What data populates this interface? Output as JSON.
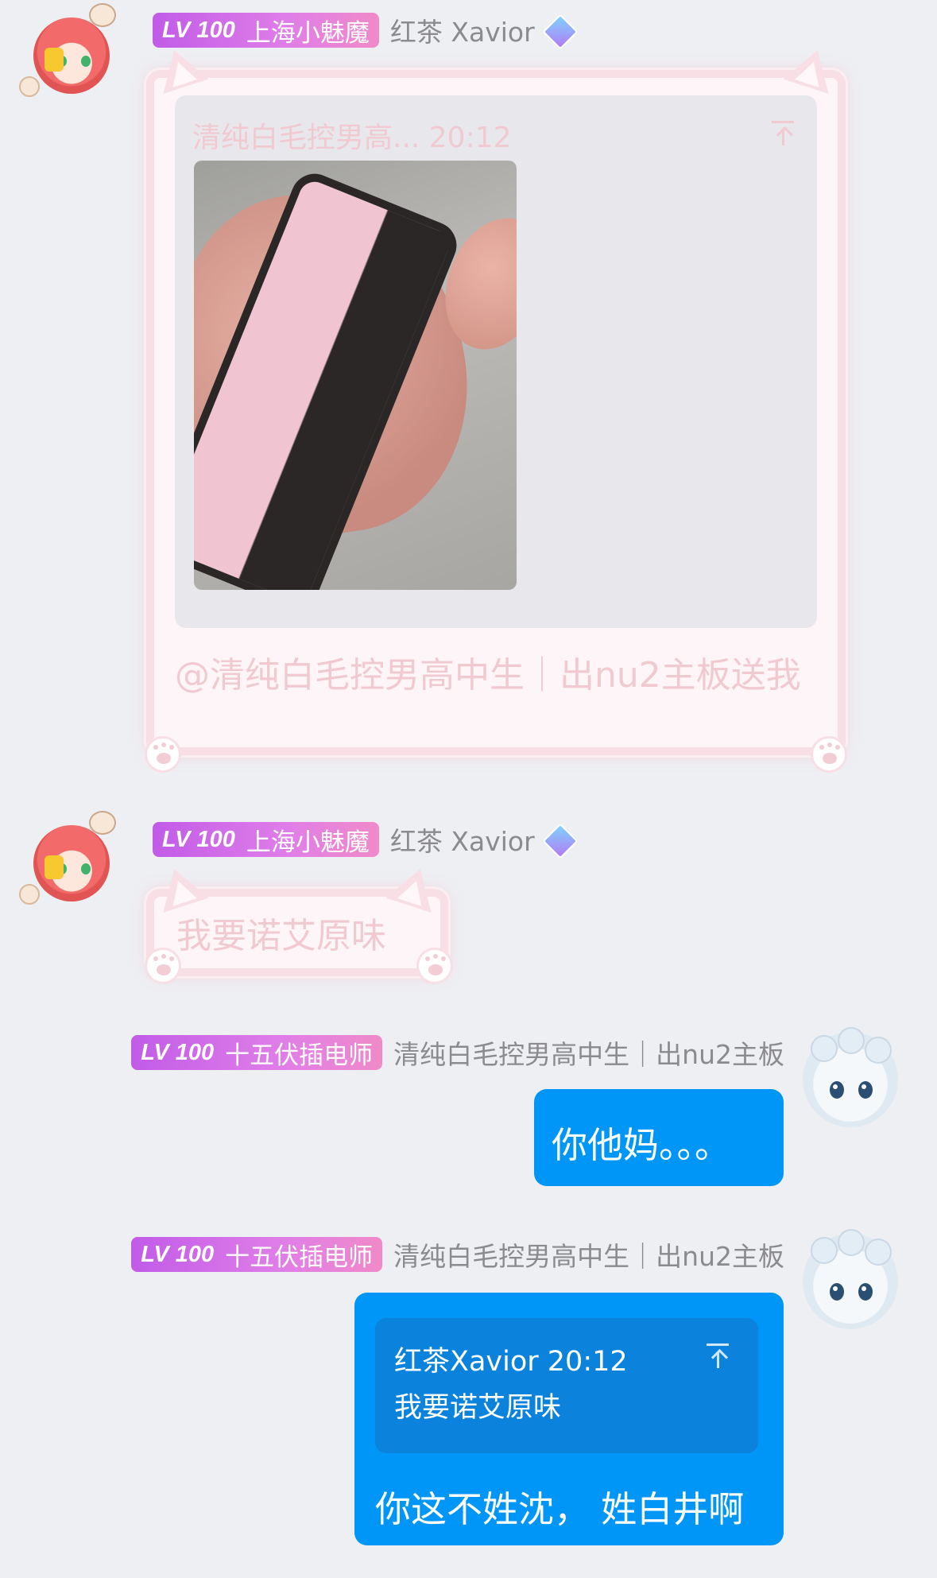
{
  "messages": [
    {
      "badge_level": "LV 100",
      "badge_title": "上海小魅魔",
      "nickname": "红茶 Xavior",
      "quote_header": "清纯白毛控男高... 20:12",
      "text": "@清纯白毛控男高中生｜出nu2主板送我"
    },
    {
      "badge_level": "LV 100",
      "badge_title": "上海小魅魔",
      "nickname": "红茶 Xavior",
      "text": "我要诺艾原味"
    },
    {
      "badge_level": "LV 100",
      "badge_title": "十五伏插电师",
      "nickname": "清纯白毛控男高中生｜出nu2主板",
      "text": "你他妈。。。"
    },
    {
      "badge_level": "LV 100",
      "badge_title": "十五伏插电师",
      "nickname": "清纯白毛控男高中生｜出nu2主板",
      "reply_header": "红茶Xavior 20:12",
      "reply_text": "我要诺艾原味",
      "text": "你这不姓沈， 姓白井啊"
    }
  ],
  "icons": {
    "avatar_left": "anime-girl-avatar",
    "avatar_right": "white-fox-avatar",
    "vip": "diamond-crown-icon",
    "reply_jump": "jump-to-top-icon"
  },
  "colors": {
    "background": "#eeeff3",
    "bubble_blue": "#0096f8",
    "badge_purple": "#c15be8",
    "frame_pink": "#f7dfe5"
  }
}
